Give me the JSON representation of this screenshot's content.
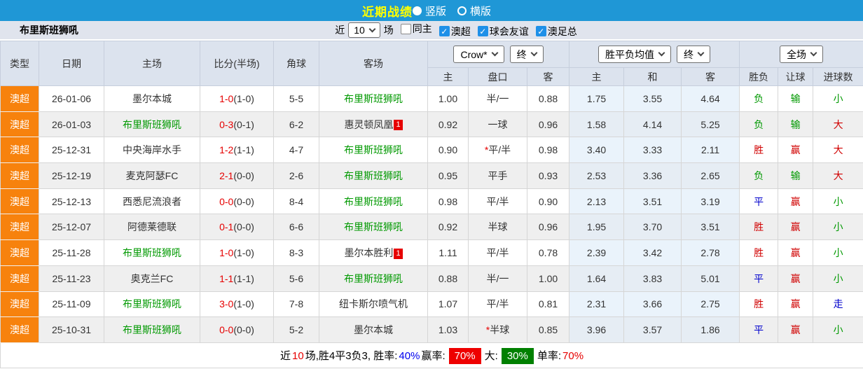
{
  "colors": {
    "top_bar_bg": "#1F97D6",
    "title_yellow": "#FFFF00",
    "league_badge_bg": "#F7820D",
    "team_green": "#009900",
    "score_red": "#E60000",
    "result_red": "#D00000",
    "result_green": "#009900",
    "result_blue": "#0000CC",
    "alt_row_bg": "#EFEFEF",
    "avg_col_bg": "#EAF3FB",
    "header_bg": "#DCE3EE",
    "filter_bg": "#E0E4ED",
    "checkbox_blue": "#1E90E8",
    "win_rate_bg": "#EE0000",
    "big_rate_bg": "#008000"
  },
  "top_bar": {
    "title": "近期战绩",
    "layout_options": [
      {
        "label": "竖版",
        "selected": true
      },
      {
        "label": "横版",
        "selected": false
      }
    ]
  },
  "filter_bar": {
    "team_name": "布里斯班狮吼",
    "recent_prefix": "近",
    "recent_count": "10",
    "recent_suffix": "场",
    "filters": [
      {
        "label": "同主",
        "checked": false
      },
      {
        "label": "澳超",
        "checked": true
      },
      {
        "label": "球会友谊",
        "checked": true
      },
      {
        "label": "澳足总",
        "checked": true
      }
    ]
  },
  "table": {
    "main_headers": {
      "type": "类型",
      "date": "日期",
      "home": "主场",
      "score": "比分(半场)",
      "corners": "角球",
      "away": "客场"
    },
    "selects": {
      "odds_company": "Crow*",
      "odds_final1": "终",
      "avg": "胜平负均值",
      "odds_final2": "终",
      "scope": "全场"
    },
    "sub_headers": [
      "主",
      "盘口",
      "客",
      "主",
      "和",
      "客",
      "胜负",
      "让球",
      "进球数"
    ],
    "rows": [
      {
        "league": "澳超",
        "date": "26-01-06",
        "home": {
          "t": "墨尔本城",
          "c": ""
        },
        "score": "1-0",
        "half": "(1-0)",
        "corners": "5-5",
        "away": {
          "t": "布里斯班狮吼",
          "c": "green"
        },
        "o1": "1.00",
        "hstar": false,
        "hcp": "半/一",
        "o2": "0.88",
        "a1": "1.75",
        "a2": "3.55",
        "a3": "4.64",
        "r1": {
          "t": "负",
          "c": "green"
        },
        "r2": {
          "t": "输",
          "c": "green"
        },
        "r3": {
          "t": "小",
          "c": "green"
        }
      },
      {
        "league": "澳超",
        "date": "26-01-03",
        "home": {
          "t": "布里斯班狮吼",
          "c": "green"
        },
        "score": "0-3",
        "half": "(0-1)",
        "corners": "6-2",
        "away": {
          "t": "惠灵顿凤凰",
          "c": "",
          "badge": "1"
        },
        "o1": "0.92",
        "hstar": false,
        "hcp": "一球",
        "o2": "0.96",
        "a1": "1.58",
        "a2": "4.14",
        "a3": "5.25",
        "r1": {
          "t": "负",
          "c": "green"
        },
        "r2": {
          "t": "输",
          "c": "green"
        },
        "r3": {
          "t": "大",
          "c": "red"
        }
      },
      {
        "league": "澳超",
        "date": "25-12-31",
        "home": {
          "t": "中央海岸水手",
          "c": ""
        },
        "score": "1-2",
        "half": "(1-1)",
        "corners": "4-7",
        "away": {
          "t": "布里斯班狮吼",
          "c": "green"
        },
        "o1": "0.90",
        "hstar": true,
        "hcp": "平/半",
        "o2": "0.98",
        "a1": "3.40",
        "a2": "3.33",
        "a3": "2.11",
        "r1": {
          "t": "胜",
          "c": "red"
        },
        "r2": {
          "t": "赢",
          "c": "red"
        },
        "r3": {
          "t": "大",
          "c": "red"
        }
      },
      {
        "league": "澳超",
        "date": "25-12-19",
        "home": {
          "t": "麦克阿瑟FC",
          "c": ""
        },
        "score": "2-1",
        "half": "(0-0)",
        "corners": "2-6",
        "away": {
          "t": "布里斯班狮吼",
          "c": "green"
        },
        "o1": "0.95",
        "hstar": false,
        "hcp": "平手",
        "o2": "0.93",
        "a1": "2.53",
        "a2": "3.36",
        "a3": "2.65",
        "r1": {
          "t": "负",
          "c": "green"
        },
        "r2": {
          "t": "输",
          "c": "green"
        },
        "r3": {
          "t": "大",
          "c": "red"
        }
      },
      {
        "league": "澳超",
        "date": "25-12-13",
        "home": {
          "t": "西悉尼流浪者",
          "c": ""
        },
        "score": "0-0",
        "half": "(0-0)",
        "corners": "8-4",
        "away": {
          "t": "布里斯班狮吼",
          "c": "green"
        },
        "o1": "0.98",
        "hstar": false,
        "hcp": "平/半",
        "o2": "0.90",
        "a1": "2.13",
        "a2": "3.51",
        "a3": "3.19",
        "r1": {
          "t": "平",
          "c": "blue"
        },
        "r2": {
          "t": "赢",
          "c": "red"
        },
        "r3": {
          "t": "小",
          "c": "green"
        }
      },
      {
        "league": "澳超",
        "date": "25-12-07",
        "home": {
          "t": "阿德莱德联",
          "c": ""
        },
        "score": "0-1",
        "half": "(0-0)",
        "corners": "6-6",
        "away": {
          "t": "布里斯班狮吼",
          "c": "green"
        },
        "o1": "0.92",
        "hstar": false,
        "hcp": "半球",
        "o2": "0.96",
        "a1": "1.95",
        "a2": "3.70",
        "a3": "3.51",
        "r1": {
          "t": "胜",
          "c": "red"
        },
        "r2": {
          "t": "赢",
          "c": "red"
        },
        "r3": {
          "t": "小",
          "c": "green"
        }
      },
      {
        "league": "澳超",
        "date": "25-11-28",
        "home": {
          "t": "布里斯班狮吼",
          "c": "green"
        },
        "score": "1-0",
        "half": "(1-0)",
        "corners": "8-3",
        "away": {
          "t": "墨尔本胜利",
          "c": "",
          "badge": "1"
        },
        "o1": "1.11",
        "hstar": false,
        "hcp": "平/半",
        "o2": "0.78",
        "a1": "2.39",
        "a2": "3.42",
        "a3": "2.78",
        "r1": {
          "t": "胜",
          "c": "red"
        },
        "r2": {
          "t": "赢",
          "c": "red"
        },
        "r3": {
          "t": "小",
          "c": "green"
        }
      },
      {
        "league": "澳超",
        "date": "25-11-23",
        "home": {
          "t": "奥克兰FC",
          "c": ""
        },
        "score": "1-1",
        "half": "(1-1)",
        "corners": "5-6",
        "away": {
          "t": "布里斯班狮吼",
          "c": "green"
        },
        "o1": "0.88",
        "hstar": false,
        "hcp": "半/一",
        "o2": "1.00",
        "a1": "1.64",
        "a2": "3.83",
        "a3": "5.01",
        "r1": {
          "t": "平",
          "c": "blue"
        },
        "r2": {
          "t": "赢",
          "c": "red"
        },
        "r3": {
          "t": "小",
          "c": "green"
        }
      },
      {
        "league": "澳超",
        "date": "25-11-09",
        "home": {
          "t": "布里斯班狮吼",
          "c": "green"
        },
        "score": "3-0",
        "half": "(1-0)",
        "corners": "7-8",
        "away": {
          "t": "纽卡斯尔喷气机",
          "c": ""
        },
        "o1": "1.07",
        "hstar": false,
        "hcp": "平/半",
        "o2": "0.81",
        "a1": "2.31",
        "a2": "3.66",
        "a3": "2.75",
        "r1": {
          "t": "胜",
          "c": "red"
        },
        "r2": {
          "t": "赢",
          "c": "red"
        },
        "r3": {
          "t": "走",
          "c": "blue"
        }
      },
      {
        "league": "澳超",
        "date": "25-10-31",
        "home": {
          "t": "布里斯班狮吼",
          "c": "green"
        },
        "score": "0-0",
        "half": "(0-0)",
        "corners": "5-2",
        "away": {
          "t": "墨尔本城",
          "c": ""
        },
        "o1": "1.03",
        "hstar": true,
        "hcp": "半球",
        "o2": "0.85",
        "a1": "3.96",
        "a2": "3.57",
        "a3": "1.86",
        "r1": {
          "t": "平",
          "c": "blue"
        },
        "r2": {
          "t": "赢",
          "c": "red"
        },
        "r3": {
          "t": "小",
          "c": "green"
        }
      }
    ]
  },
  "summary": {
    "segments": [
      {
        "text": "近",
        "style": "plain"
      },
      {
        "text": "10",
        "style": "red"
      },
      {
        "text": "场,胜4平3负3, 胜率:",
        "style": "plain"
      },
      {
        "text": "40%",
        "style": "blue"
      },
      {
        "text": "赢率:",
        "style": "plain"
      },
      {
        "text": "70%",
        "style": "red-bg"
      },
      {
        "text": "大:",
        "style": "plain"
      },
      {
        "text": "30%",
        "style": "green-bg"
      },
      {
        "text": "单率:",
        "style": "plain"
      },
      {
        "text": "70%",
        "style": "red"
      }
    ]
  }
}
